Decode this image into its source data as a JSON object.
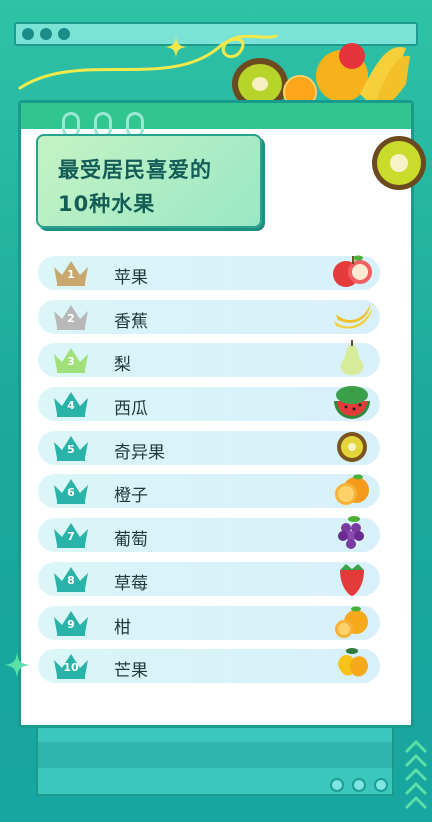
{
  "title": {
    "line1": "最受居民喜爱的",
    "line2": "10种水果"
  },
  "ranking": [
    {
      "rank": "1",
      "name": "苹果",
      "icon": "apple-icon",
      "crown_color": "#c9a870"
    },
    {
      "rank": "2",
      "name": "香蕉",
      "icon": "banana-icon",
      "crown_color": "#b8b8b8"
    },
    {
      "rank": "3",
      "name": "梨",
      "icon": "pear-icon",
      "crown_color": "#9fe07a"
    },
    {
      "rank": "4",
      "name": "西瓜",
      "icon": "watermelon-icon",
      "crown_color": "#2ab3a9"
    },
    {
      "rank": "5",
      "name": "奇异果",
      "icon": "kiwi-icon",
      "crown_color": "#2ab3a9"
    },
    {
      "rank": "6",
      "name": "橙子",
      "icon": "orange-icon",
      "crown_color": "#2ab3a9"
    },
    {
      "rank": "7",
      "name": "葡萄",
      "icon": "grape-icon",
      "crown_color": "#2ab3a9"
    },
    {
      "rank": "8",
      "name": "草莓",
      "icon": "strawberry-icon",
      "crown_color": "#2ab3a9"
    },
    {
      "rank": "9",
      "name": "柑",
      "icon": "tangerine-icon",
      "crown_color": "#2ab3a9"
    },
    {
      "rank": "10",
      "name": "芒果",
      "icon": "mango-icon",
      "crown_color": "#2ab3a9"
    }
  ],
  "colors": {
    "background": "#2fc2a7",
    "card": "#ffffff",
    "title_text": "#145c57",
    "row_fill": "#daf6f7"
  }
}
